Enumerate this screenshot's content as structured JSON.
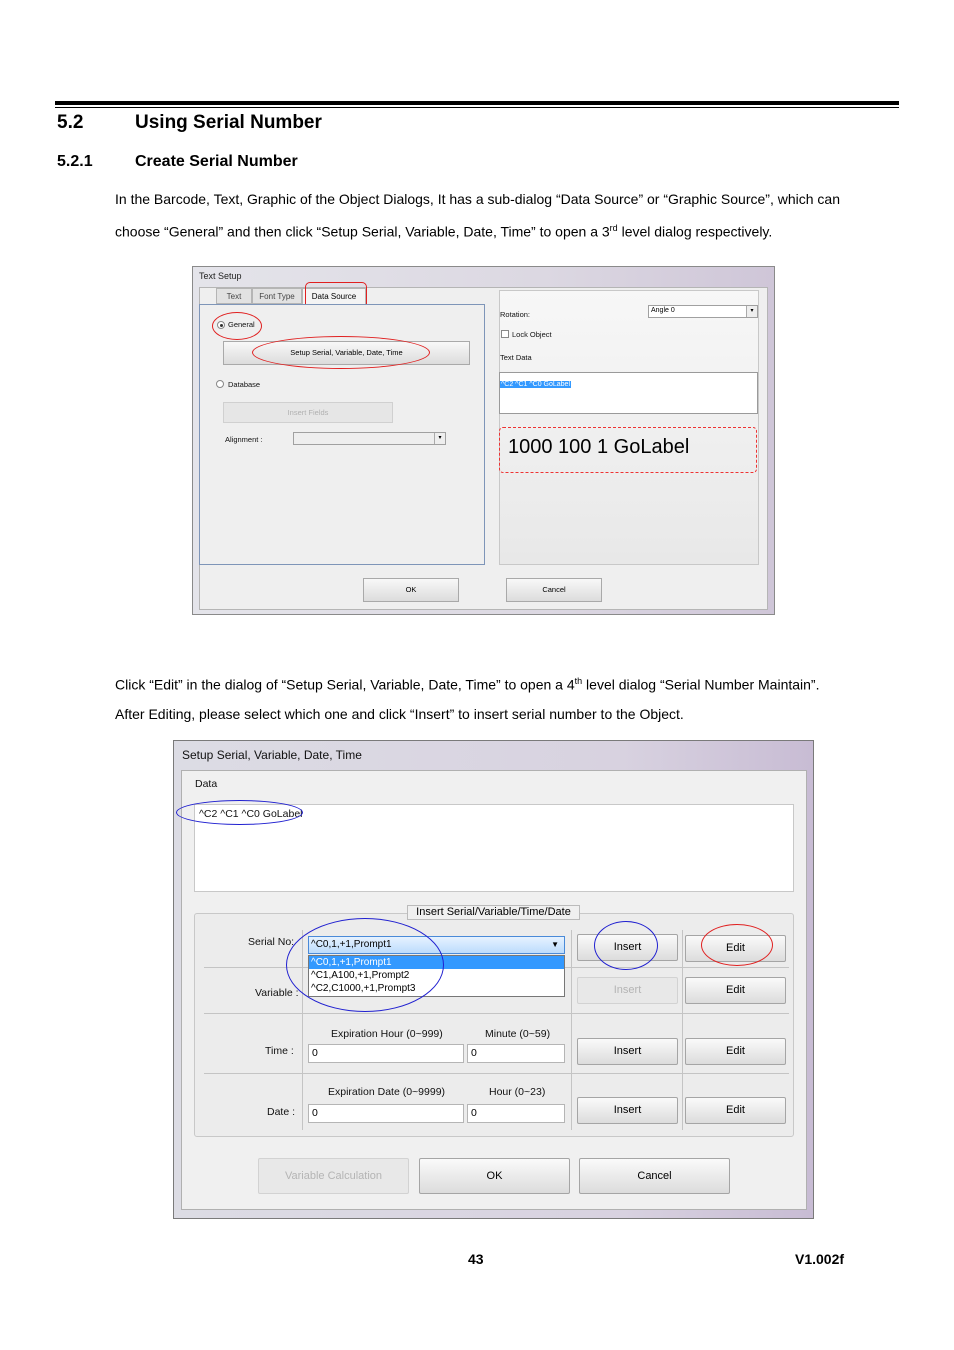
{
  "section": {
    "number": "5.2",
    "title": "Using Serial Number"
  },
  "subsection": {
    "number": "5.2.1",
    "title": "Create Serial Number"
  },
  "para1": {
    "line1": "In the Barcode, Text, Graphic of the Object Dialogs, It has a sub-dialog “Data Source” or “Graphic Source”, which can",
    "line2a": "choose “General” and then click “Setup Serial, Variable, Date, Time” to open a 3",
    "line2sup": "rd",
    "line2b": " level dialog respectively."
  },
  "text_setup": {
    "title": "Text Setup",
    "tabs": [
      "Text",
      "Font Type",
      "Data Source"
    ],
    "general_label": "General",
    "setup_button": "Setup Serial, Variable, Date, Time",
    "database_label": "Database",
    "insert_fields": "Insert Fields",
    "alignment_label": "Alignment :",
    "rotation_label": "Rotation:",
    "rotation_value": "Angle 0",
    "lock_object": "Lock Object",
    "text_data_label": "Text Data",
    "text_data_value": "^C2 ^C1 ^C0 GoLabel",
    "preview": "1000 100 1 GoLabel",
    "ok": "OK",
    "cancel": "Cancel"
  },
  "para2": {
    "line1a": "Click “Edit” in the dialog of “Setup Serial, Variable, Date, Time” to open a 4",
    "line1sup": "th",
    "line1b": " level dialog “Serial Number Maintain”.",
    "line2": "After Editing, please select which one and click “Insert” to insert serial number to the Object."
  },
  "setup_serial": {
    "title": "Setup Serial, Variable, Date, Time",
    "data_label": "Data",
    "data_value": "^C2 ^C1 ^C0 GoLabel",
    "group_title": "Insert Serial/Variable/Time/Date",
    "serial_label": "Serial No:",
    "serial_selected": "^C0,1,+1,Prompt1",
    "serial_options": [
      "^C0,1,+1,Prompt1",
      "^C1,A100,+1,Prompt2",
      "^C2,C1000,+1,Prompt3"
    ],
    "variable_label": "Variable :",
    "time_label": "Time :",
    "exp_hour_label": "Expiration Hour (0~999)",
    "minute_label": "Minute (0~59)",
    "time_hour_value": "0",
    "time_minute_value": "0",
    "date_label": "Date :",
    "exp_date_label": "Expiration Date (0~9999)",
    "hour_label": "Hour (0~23)",
    "date_value": "0",
    "date_hour_value": "0",
    "insert": "Insert",
    "edit": "Edit",
    "var_calc": "Variable Calculation",
    "ok": "OK",
    "cancel": "Cancel"
  },
  "footer": {
    "page": "43",
    "version": "V1.002f"
  }
}
